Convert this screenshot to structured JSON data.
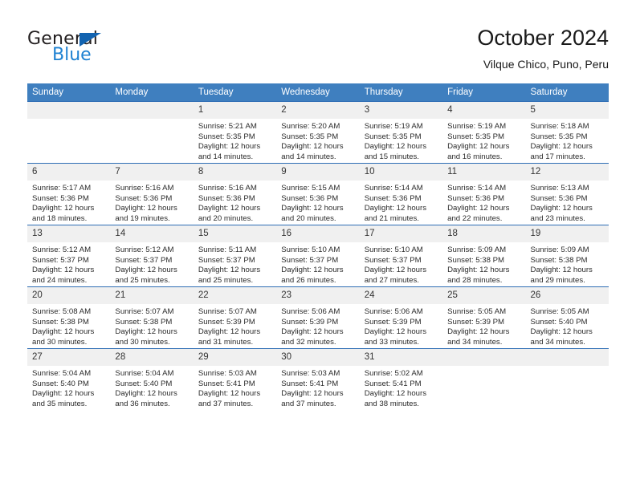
{
  "brand": {
    "name_part1": "General",
    "name_part2": "Blue",
    "triangle_color": "#1263b0",
    "blue_color": "#1f82d2"
  },
  "header": {
    "title": "October 2024",
    "location": "Vilque Chico, Puno, Peru"
  },
  "theme": {
    "header_row_bg": "#3f7fbf",
    "header_row_text": "#ffffff",
    "row_divider": "#2f6eb5",
    "daynum_bg": "#f0f0f0"
  },
  "weekday_headers": [
    "Sunday",
    "Monday",
    "Tuesday",
    "Wednesday",
    "Thursday",
    "Friday",
    "Saturday"
  ],
  "weeks": [
    [
      {
        "day": "",
        "sunrise": "",
        "sunset": "",
        "daylight_line1": "",
        "daylight_line2": ""
      },
      {
        "day": "",
        "sunrise": "",
        "sunset": "",
        "daylight_line1": "",
        "daylight_line2": ""
      },
      {
        "day": "1",
        "sunrise": "Sunrise: 5:21 AM",
        "sunset": "Sunset: 5:35 PM",
        "daylight_line1": "Daylight: 12 hours",
        "daylight_line2": "and 14 minutes."
      },
      {
        "day": "2",
        "sunrise": "Sunrise: 5:20 AM",
        "sunset": "Sunset: 5:35 PM",
        "daylight_line1": "Daylight: 12 hours",
        "daylight_line2": "and 14 minutes."
      },
      {
        "day": "3",
        "sunrise": "Sunrise: 5:19 AM",
        "sunset": "Sunset: 5:35 PM",
        "daylight_line1": "Daylight: 12 hours",
        "daylight_line2": "and 15 minutes."
      },
      {
        "day": "4",
        "sunrise": "Sunrise: 5:19 AM",
        "sunset": "Sunset: 5:35 PM",
        "daylight_line1": "Daylight: 12 hours",
        "daylight_line2": "and 16 minutes."
      },
      {
        "day": "5",
        "sunrise": "Sunrise: 5:18 AM",
        "sunset": "Sunset: 5:35 PM",
        "daylight_line1": "Daylight: 12 hours",
        "daylight_line2": "and 17 minutes."
      }
    ],
    [
      {
        "day": "6",
        "sunrise": "Sunrise: 5:17 AM",
        "sunset": "Sunset: 5:36 PM",
        "daylight_line1": "Daylight: 12 hours",
        "daylight_line2": "and 18 minutes."
      },
      {
        "day": "7",
        "sunrise": "Sunrise: 5:16 AM",
        "sunset": "Sunset: 5:36 PM",
        "daylight_line1": "Daylight: 12 hours",
        "daylight_line2": "and 19 minutes."
      },
      {
        "day": "8",
        "sunrise": "Sunrise: 5:16 AM",
        "sunset": "Sunset: 5:36 PM",
        "daylight_line1": "Daylight: 12 hours",
        "daylight_line2": "and 20 minutes."
      },
      {
        "day": "9",
        "sunrise": "Sunrise: 5:15 AM",
        "sunset": "Sunset: 5:36 PM",
        "daylight_line1": "Daylight: 12 hours",
        "daylight_line2": "and 20 minutes."
      },
      {
        "day": "10",
        "sunrise": "Sunrise: 5:14 AM",
        "sunset": "Sunset: 5:36 PM",
        "daylight_line1": "Daylight: 12 hours",
        "daylight_line2": "and 21 minutes."
      },
      {
        "day": "11",
        "sunrise": "Sunrise: 5:14 AM",
        "sunset": "Sunset: 5:36 PM",
        "daylight_line1": "Daylight: 12 hours",
        "daylight_line2": "and 22 minutes."
      },
      {
        "day": "12",
        "sunrise": "Sunrise: 5:13 AM",
        "sunset": "Sunset: 5:36 PM",
        "daylight_line1": "Daylight: 12 hours",
        "daylight_line2": "and 23 minutes."
      }
    ],
    [
      {
        "day": "13",
        "sunrise": "Sunrise: 5:12 AM",
        "sunset": "Sunset: 5:37 PM",
        "daylight_line1": "Daylight: 12 hours",
        "daylight_line2": "and 24 minutes."
      },
      {
        "day": "14",
        "sunrise": "Sunrise: 5:12 AM",
        "sunset": "Sunset: 5:37 PM",
        "daylight_line1": "Daylight: 12 hours",
        "daylight_line2": "and 25 minutes."
      },
      {
        "day": "15",
        "sunrise": "Sunrise: 5:11 AM",
        "sunset": "Sunset: 5:37 PM",
        "daylight_line1": "Daylight: 12 hours",
        "daylight_line2": "and 25 minutes."
      },
      {
        "day": "16",
        "sunrise": "Sunrise: 5:10 AM",
        "sunset": "Sunset: 5:37 PM",
        "daylight_line1": "Daylight: 12 hours",
        "daylight_line2": "and 26 minutes."
      },
      {
        "day": "17",
        "sunrise": "Sunrise: 5:10 AM",
        "sunset": "Sunset: 5:37 PM",
        "daylight_line1": "Daylight: 12 hours",
        "daylight_line2": "and 27 minutes."
      },
      {
        "day": "18",
        "sunrise": "Sunrise: 5:09 AM",
        "sunset": "Sunset: 5:38 PM",
        "daylight_line1": "Daylight: 12 hours",
        "daylight_line2": "and 28 minutes."
      },
      {
        "day": "19",
        "sunrise": "Sunrise: 5:09 AM",
        "sunset": "Sunset: 5:38 PM",
        "daylight_line1": "Daylight: 12 hours",
        "daylight_line2": "and 29 minutes."
      }
    ],
    [
      {
        "day": "20",
        "sunrise": "Sunrise: 5:08 AM",
        "sunset": "Sunset: 5:38 PM",
        "daylight_line1": "Daylight: 12 hours",
        "daylight_line2": "and 30 minutes."
      },
      {
        "day": "21",
        "sunrise": "Sunrise: 5:07 AM",
        "sunset": "Sunset: 5:38 PM",
        "daylight_line1": "Daylight: 12 hours",
        "daylight_line2": "and 30 minutes."
      },
      {
        "day": "22",
        "sunrise": "Sunrise: 5:07 AM",
        "sunset": "Sunset: 5:39 PM",
        "daylight_line1": "Daylight: 12 hours",
        "daylight_line2": "and 31 minutes."
      },
      {
        "day": "23",
        "sunrise": "Sunrise: 5:06 AM",
        "sunset": "Sunset: 5:39 PM",
        "daylight_line1": "Daylight: 12 hours",
        "daylight_line2": "and 32 minutes."
      },
      {
        "day": "24",
        "sunrise": "Sunrise: 5:06 AM",
        "sunset": "Sunset: 5:39 PM",
        "daylight_line1": "Daylight: 12 hours",
        "daylight_line2": "and 33 minutes."
      },
      {
        "day": "25",
        "sunrise": "Sunrise: 5:05 AM",
        "sunset": "Sunset: 5:39 PM",
        "daylight_line1": "Daylight: 12 hours",
        "daylight_line2": "and 34 minutes."
      },
      {
        "day": "26",
        "sunrise": "Sunrise: 5:05 AM",
        "sunset": "Sunset: 5:40 PM",
        "daylight_line1": "Daylight: 12 hours",
        "daylight_line2": "and 34 minutes."
      }
    ],
    [
      {
        "day": "27",
        "sunrise": "Sunrise: 5:04 AM",
        "sunset": "Sunset: 5:40 PM",
        "daylight_line1": "Daylight: 12 hours",
        "daylight_line2": "and 35 minutes."
      },
      {
        "day": "28",
        "sunrise": "Sunrise: 5:04 AM",
        "sunset": "Sunset: 5:40 PM",
        "daylight_line1": "Daylight: 12 hours",
        "daylight_line2": "and 36 minutes."
      },
      {
        "day": "29",
        "sunrise": "Sunrise: 5:03 AM",
        "sunset": "Sunset: 5:41 PM",
        "daylight_line1": "Daylight: 12 hours",
        "daylight_line2": "and 37 minutes."
      },
      {
        "day": "30",
        "sunrise": "Sunrise: 5:03 AM",
        "sunset": "Sunset: 5:41 PM",
        "daylight_line1": "Daylight: 12 hours",
        "daylight_line2": "and 37 minutes."
      },
      {
        "day": "31",
        "sunrise": "Sunrise: 5:02 AM",
        "sunset": "Sunset: 5:41 PM",
        "daylight_line1": "Daylight: 12 hours",
        "daylight_line2": "and 38 minutes."
      },
      {
        "day": "",
        "sunrise": "",
        "sunset": "",
        "daylight_line1": "",
        "daylight_line2": ""
      },
      {
        "day": "",
        "sunrise": "",
        "sunset": "",
        "daylight_line1": "",
        "daylight_line2": ""
      }
    ]
  ]
}
